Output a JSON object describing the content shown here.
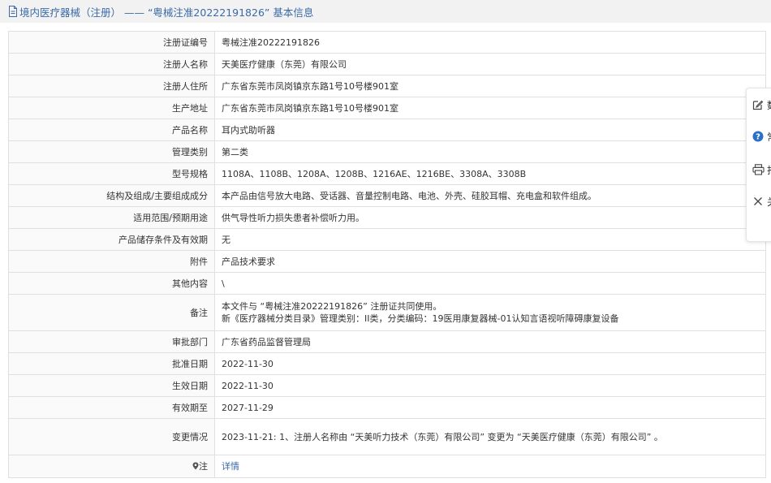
{
  "header": {
    "title": "境内医疗器械（注册） —— “粤械注准20222191826” 基本信息"
  },
  "rows": [
    {
      "label": "注册证编号",
      "value": [
        "粤械注准20222191826"
      ]
    },
    {
      "label": "注册人名称",
      "value": [
        "天美医疗健康（东莞）有限公司"
      ]
    },
    {
      "label": "注册人住所",
      "value": [
        "广东省东莞市凤岗镇京东路1号10号楼901室"
      ]
    },
    {
      "label": "生产地址",
      "value": [
        "广东省东莞市凤岗镇京东路1号10号楼901室"
      ]
    },
    {
      "label": "产品名称",
      "value": [
        "耳内式助听器"
      ]
    },
    {
      "label": "管理类别",
      "value": [
        "第二类"
      ]
    },
    {
      "label": "型号规格",
      "value": [
        "1108A、1108B、1208A、1208B、1216AE、1216BE、3308A、3308B"
      ]
    },
    {
      "label": "结构及组成/主要组成成分",
      "value": [
        "本产品由信号放大电路、受话器、音量控制电路、电池、外壳、硅胶耳帽、充电盒和软件组成。"
      ]
    },
    {
      "label": "适用范围/预期用途",
      "value": [
        "供气导性听力损失患者补偿听力用。"
      ]
    },
    {
      "label": "产品储存条件及有效期",
      "value": [
        "无"
      ]
    },
    {
      "label": "附件",
      "value": [
        "产品技术要求"
      ]
    },
    {
      "label": "其他内容",
      "value": [
        "\\"
      ]
    },
    {
      "label": "备注",
      "value": [
        "本文件与 “粤械注准20222191826” 注册证共同使用。",
        "新《医疗器械分类目录》管理类别：II类，分类编码：19医用康复器械-01认知言语视听障碍康复设备"
      ]
    },
    {
      "label": "审批部门",
      "value": [
        "广东省药品监督管理局"
      ]
    },
    {
      "label": "批准日期",
      "value": [
        "2022-11-30"
      ]
    },
    {
      "label": "生效日期",
      "value": [
        "2022-11-30"
      ]
    },
    {
      "label": "有效期至",
      "value": [
        "2027-11-29"
      ]
    },
    {
      "label": "变更情况",
      "value": [
        "2023-11-21: 1、注册人名称由 “天美听力技术（东莞）有限公司” 变更为 “天美医疗健康（东莞）有限公司” 。"
      ]
    },
    {
      "label": "注",
      "value": [
        "详情"
      ],
      "label_icon": "pin-icon",
      "link": true
    }
  ],
  "float_toolbar": [
    {
      "icon": "edit-icon",
      "label": "数"
    },
    {
      "icon": "help-icon",
      "label": "常"
    },
    {
      "icon": "print-icon",
      "label": "打"
    },
    {
      "icon": "close-icon",
      "label": "关"
    }
  ],
  "colors": {
    "accent": "#3a6aa8",
    "help": "#2b6fc7"
  }
}
